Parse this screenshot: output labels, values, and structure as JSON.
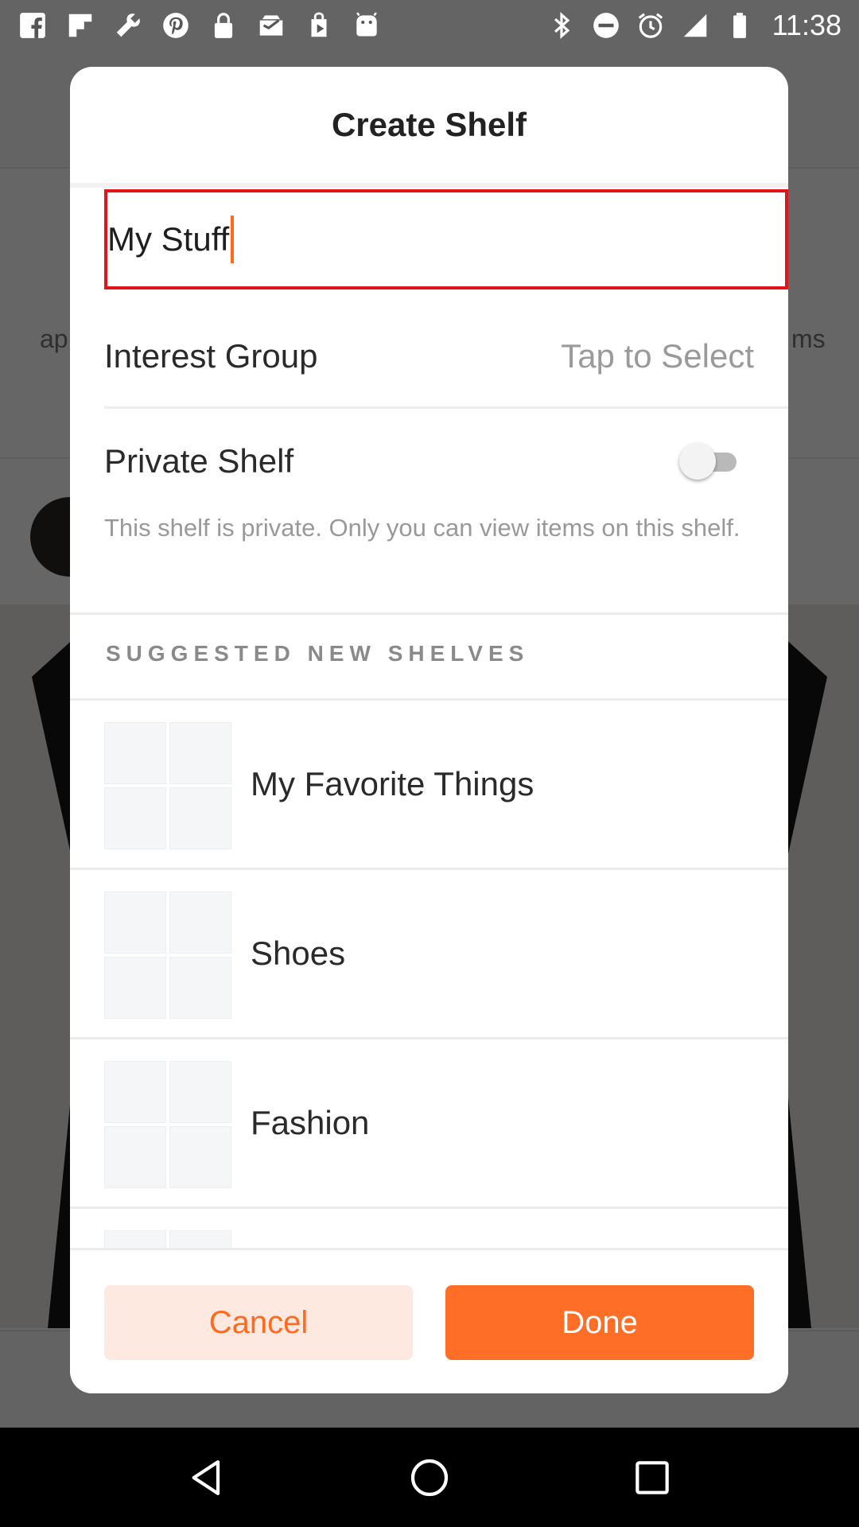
{
  "status_bar": {
    "left_icons": [
      "facebook-icon",
      "flipboard-icon",
      "wrench-icon",
      "pinterest-icon",
      "lock-icon",
      "inbox-icon",
      "play-store-icon",
      "android-debug-icon"
    ],
    "right_icons": [
      "bluetooth-icon",
      "do-not-disturb-icon",
      "alarm-icon",
      "signal-icon",
      "battery-icon"
    ],
    "time": "11:38"
  },
  "background": {
    "tab_left": "ap",
    "tab_right": "ms"
  },
  "dialog": {
    "title": "Create Shelf",
    "name_field": {
      "value": "My Stuff"
    },
    "interest_group": {
      "label": "Interest Group",
      "value": "Tap to Select"
    },
    "private_shelf": {
      "label": "Private Shelf",
      "enabled": false
    },
    "private_description": "This shelf is private. Only you can view items on this shelf.",
    "suggested_header": "SUGGESTED NEW SHELVES",
    "suggestions": [
      {
        "label": "My Favorite Things"
      },
      {
        "label": "Shoes"
      },
      {
        "label": "Fashion"
      }
    ],
    "cancel_label": "Cancel",
    "done_label": "Done"
  },
  "colors": {
    "accent": "#ff6e26",
    "cancel_bg": "#fde9e0",
    "field_border": "#e0141b"
  },
  "nav_bar": {
    "icons": [
      "back-icon",
      "home-icon",
      "recents-icon"
    ]
  }
}
